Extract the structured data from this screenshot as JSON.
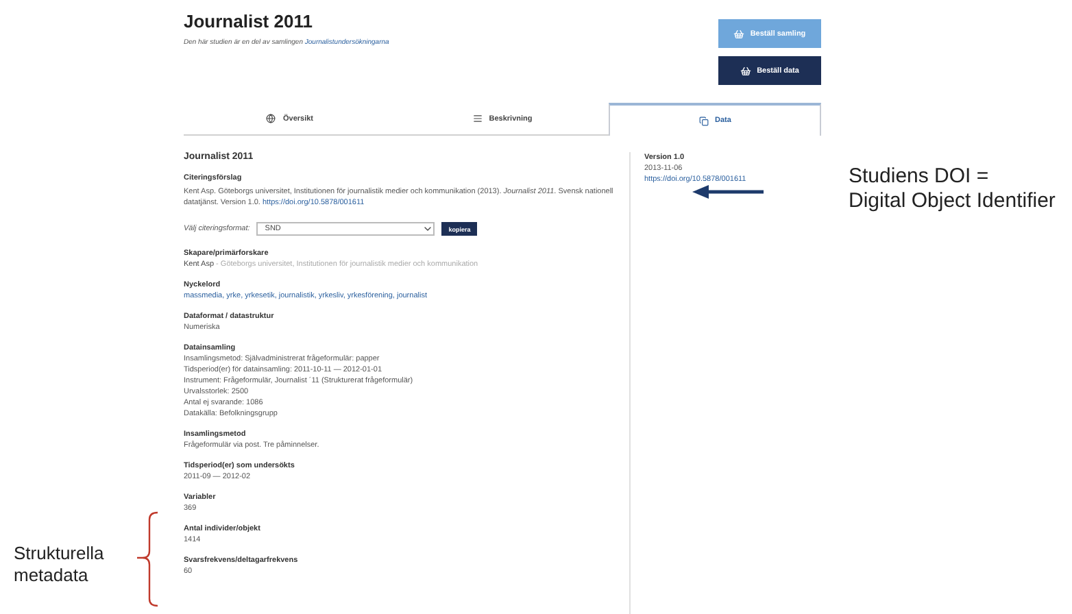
{
  "header": {
    "title": "Journalist 2011",
    "subtitle": "Den här studien är en del av samlingen ",
    "subtitle_link": "Journalistundersökningarna"
  },
  "buttons": [
    {
      "label": "Beställ samling",
      "kind": "light"
    },
    {
      "label": "Beställ data",
      "kind": "dark"
    }
  ],
  "tabs": [
    {
      "label": "Översikt",
      "kind": "overview",
      "selected": false
    },
    {
      "label": "Beskrivning",
      "kind": "description",
      "selected": false
    },
    {
      "label": "Data",
      "kind": "data",
      "selected": true
    }
  ],
  "study_title": "Journalist 2011",
  "citation": {
    "heading": "Citeringsförslag",
    "text": "Kent Asp. Göteborgs universitet, Institutionen för journalistik medier och kommunikation (2013). *Journalist 2011*. Svensk nationell datatjänst. Version 1.0. ",
    "link": "https://doi.org/10.5878/001611"
  },
  "citation_format": {
    "label": "Välj citeringsformat:",
    "value": "SND",
    "button": "kopiera"
  },
  "creator": {
    "heading": "Skapare/primärforskare",
    "name": "Kent Asp",
    "affiliation": " - Göteborgs universitet, Institutionen för journalistik medier och kommunikation"
  },
  "keywords": {
    "heading": "Nyckelord",
    "text": "massmedia, yrke, yrkesetik, journalistik, yrkesliv, yrkesförening, journalist"
  },
  "sections": [
    {
      "heading": "Dataformat / datastruktur",
      "lines": [
        "Numeriska"
      ]
    },
    {
      "heading": "Datainsamling",
      "lines": [
        "Insamlingsmetod: Självadministrerat frågeformulär: papper",
        "Tidsperiod(er) för datainsamling: 2011-10-11 — 2012-01-01",
        "Instrument: Frågeformulär, Journalist ´11 (Strukturerat frågeformulär)",
        "Urvalsstorlek: 2500",
        "Antal ej svarande: 1086",
        "Datakälla: Befolkningsgrupp"
      ]
    },
    {
      "heading": "Insamlingsmetod",
      "lines": [
        "Frågeformulär via post. Tre påminnelser."
      ]
    },
    {
      "heading": "Tidsperiod(er) som undersökts",
      "lines": [
        "2011-09 — 2012-02"
      ]
    },
    {
      "heading": "Variabler",
      "lines": [
        "369"
      ]
    },
    {
      "heading": "Antal individer/objekt",
      "lines": [
        "1414"
      ]
    },
    {
      "heading": "Svarsfrekvens/deltagarfrekvens",
      "lines": [
        "60"
      ]
    }
  ],
  "version": {
    "heading": "Version 1.0",
    "date": "2013-11-06",
    "link": "https://doi.org/10.5878/001611"
  },
  "annotations": {
    "doi": [
      "Studiens DOI =",
      "Digital Object Identifier"
    ],
    "metadata": [
      "Strukturella",
      "metadata"
    ]
  }
}
